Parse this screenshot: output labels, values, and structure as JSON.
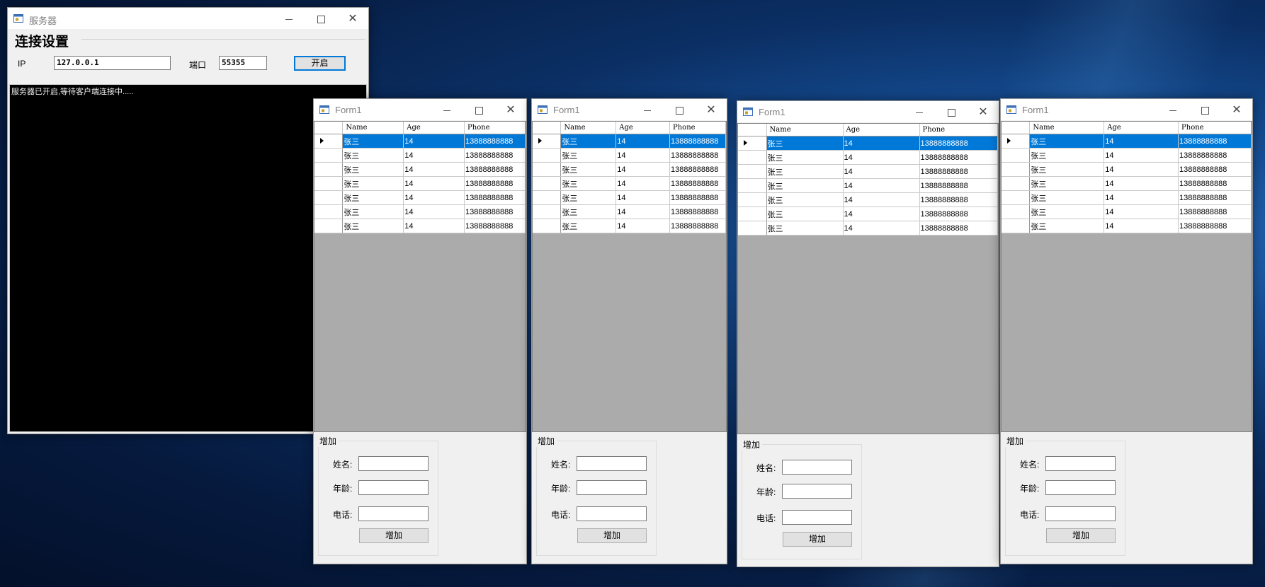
{
  "server": {
    "title": "服务器",
    "heading": "连接设置",
    "ip_label": "IP",
    "ip_value": "127.0.0.1",
    "port_label": "端口",
    "port_value": "55355",
    "start_button": "开启",
    "console_text": "服务器已开启,等待客户端连接中....."
  },
  "clients": [
    {
      "title": "Form1",
      "columns": [
        "Name",
        "Age",
        "Phone"
      ],
      "rows": [
        [
          "张三",
          "14",
          "13888888888"
        ],
        [
          "张三",
          "14",
          "13888888888"
        ],
        [
          "张三",
          "14",
          "13888888888"
        ],
        [
          "张三",
          "14",
          "13888888888"
        ],
        [
          "张三",
          "14",
          "13888888888"
        ],
        [
          "张三",
          "14",
          "13888888888"
        ],
        [
          "张三",
          "14",
          "13888888888"
        ]
      ],
      "group_title": "增加",
      "name_label": "姓名:",
      "age_label": "年龄:",
      "phone_label": "电话:",
      "add_button": "增加"
    },
    {
      "title": "Form1",
      "columns": [
        "Name",
        "Age",
        "Phone"
      ],
      "rows": [
        [
          "张三",
          "14",
          "13888888888"
        ],
        [
          "张三",
          "14",
          "13888888888"
        ],
        [
          "张三",
          "14",
          "13888888888"
        ],
        [
          "张三",
          "14",
          "13888888888"
        ],
        [
          "张三",
          "14",
          "13888888888"
        ],
        [
          "张三",
          "14",
          "13888888888"
        ],
        [
          "张三",
          "14",
          "13888888888"
        ]
      ],
      "group_title": "增加",
      "name_label": "姓名:",
      "age_label": "年龄:",
      "phone_label": "电话:",
      "add_button": "增加"
    },
    {
      "title": "Form1",
      "columns": [
        "Name",
        "Age",
        "Phone"
      ],
      "rows": [
        [
          "张三",
          "14",
          "13888888888"
        ],
        [
          "张三",
          "14",
          "13888888888"
        ],
        [
          "张三",
          "14",
          "13888888888"
        ],
        [
          "张三",
          "14",
          "13888888888"
        ],
        [
          "张三",
          "14",
          "13888888888"
        ],
        [
          "张三",
          "14",
          "13888888888"
        ],
        [
          "张三",
          "14",
          "13888888888"
        ]
      ],
      "group_title": "增加",
      "name_label": "姓名:",
      "age_label": "年龄:",
      "phone_label": "电话:",
      "add_button": "增加"
    },
    {
      "title": "Form1",
      "columns": [
        "Name",
        "Age",
        "Phone"
      ],
      "rows": [
        [
          "张三",
          "14",
          "13888888888"
        ],
        [
          "张三",
          "14",
          "13888888888"
        ],
        [
          "张三",
          "14",
          "13888888888"
        ],
        [
          "张三",
          "14",
          "13888888888"
        ],
        [
          "张三",
          "14",
          "13888888888"
        ],
        [
          "张三",
          "14",
          "13888888888"
        ],
        [
          "张三",
          "14",
          "13888888888"
        ]
      ],
      "group_title": "增加",
      "name_label": "姓名:",
      "age_label": "年龄:",
      "phone_label": "电话:",
      "add_button": "增加"
    }
  ],
  "icons": {
    "app_icon": "window-app-icon",
    "minimize": "minimize-icon",
    "maximize": "maximize-icon",
    "close": "close-icon",
    "current_row": "row-pointer-icon"
  },
  "colors": {
    "selection": "#0078d7",
    "grid_background": "#ababab",
    "console_background": "#000000"
  }
}
